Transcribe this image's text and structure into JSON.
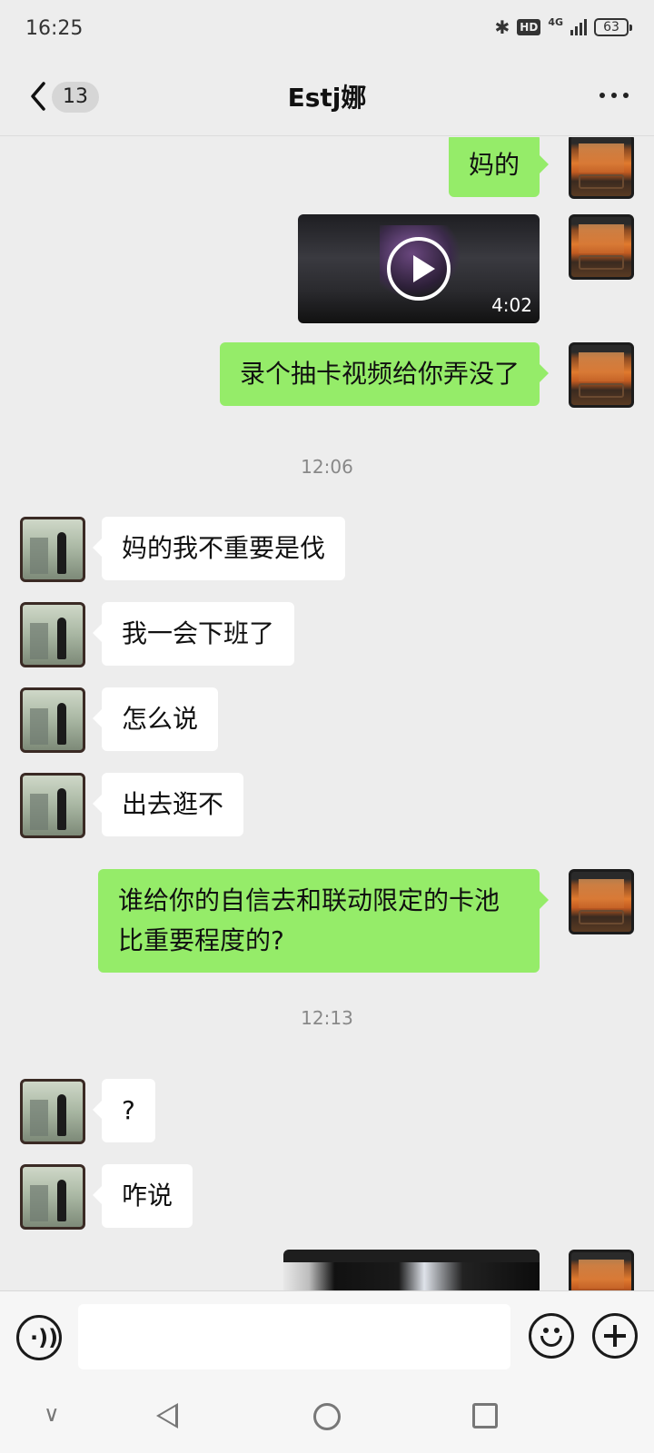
{
  "status_bar": {
    "time": "16:25",
    "bluetooth_icon": "bluetooth-icon",
    "hd_label": "HD",
    "network_label": "4G",
    "battery": "63"
  },
  "header": {
    "unread_count": "13",
    "title": "Estj娜",
    "back_icon": "chevron-left-icon",
    "more_icon": "more-dots-icon"
  },
  "messages": [
    {
      "side": "me",
      "type": "text",
      "text": "妈的"
    },
    {
      "side": "me",
      "type": "video",
      "duration": "4:02"
    },
    {
      "side": "me",
      "type": "text",
      "text": "录个抽卡视频给你弄没了"
    },
    {
      "type": "time",
      "text": "12:06"
    },
    {
      "side": "other",
      "type": "text",
      "text": "妈的我不重要是伐"
    },
    {
      "side": "other",
      "type": "text",
      "text": "我一会下班了"
    },
    {
      "side": "other",
      "type": "text",
      "text": "怎么说"
    },
    {
      "side": "other",
      "type": "text",
      "text": "出去逛不"
    },
    {
      "side": "me",
      "type": "text",
      "text": "谁给你的自信去和联动限定的卡池比重要程度的?"
    },
    {
      "type": "time",
      "text": "12:13"
    },
    {
      "side": "other",
      "type": "text",
      "text": "?"
    },
    {
      "side": "other",
      "type": "text",
      "text": "咋说"
    },
    {
      "side": "me",
      "type": "video",
      "duration": ""
    }
  ],
  "input_bar": {
    "voice_icon": "voice-icon",
    "voice_glyph": "·))",
    "emoji_icon": "emoji-icon",
    "add_icon": "plus-icon"
  },
  "nav_bar": {
    "down_glyph": "∨"
  },
  "colors": {
    "background": "#ededed",
    "my_bubble": "#95ec69",
    "other_bubble": "#ffffff",
    "timestamp": "#888888"
  }
}
